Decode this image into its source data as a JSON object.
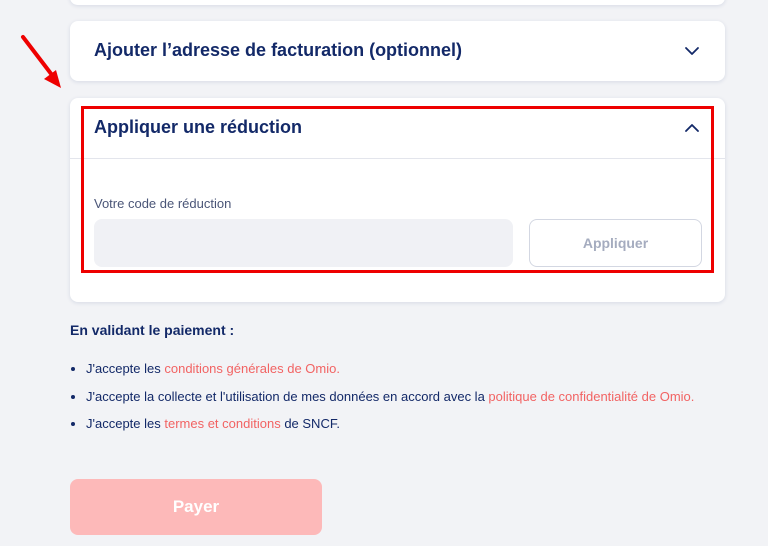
{
  "billing_section": {
    "title": "Ajouter l’adresse de facturation (optionnel)",
    "chevron_icon": "chevron-down-icon"
  },
  "discount_section": {
    "title": "Appliquer une réduction",
    "chevron_icon": "chevron-up-icon",
    "code_label": "Votre code de réduction",
    "code_value": "",
    "apply_label": "Appliquer"
  },
  "annotation": {
    "highlight_color": "#ee0000",
    "arrow_icon": "arrow-pointer-icon"
  },
  "terms": {
    "heading": "En validant le paiement :",
    "item1_prefix": "J'accepte les ",
    "item1_link": "conditions générales de Omio.",
    "item2_prefix": "J'accepte la collecte et l'utilisation de mes données en accord avec la ",
    "item2_link": "politique de confidentialité de Omio.",
    "item3_prefix": "J'accepte les ",
    "item3_link": "termes et conditions",
    "item3_suffix": " de SNCF."
  },
  "pay_button": {
    "label": "Payer",
    "color": "#fdb9b9"
  },
  "colors": {
    "text": "#132968",
    "link": "#f26363",
    "background": "#f2f3f6"
  }
}
